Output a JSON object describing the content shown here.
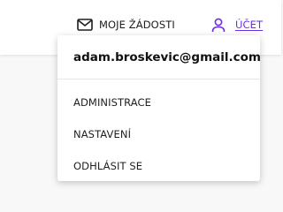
{
  "header": {
    "requests_label": "MOJE ŽÁDOSTI",
    "requests_icon": "mail-icon",
    "account_label": "ÚČET",
    "account_icon": "user-icon",
    "accent_color": "#6a2ee8"
  },
  "dropdown": {
    "email": "adam.broskevic@gmail.com",
    "items": [
      {
        "label": "ADMINISTRACE"
      },
      {
        "label": "NASTAVENÍ"
      },
      {
        "label": "ODHLÁSIT SE"
      }
    ]
  }
}
